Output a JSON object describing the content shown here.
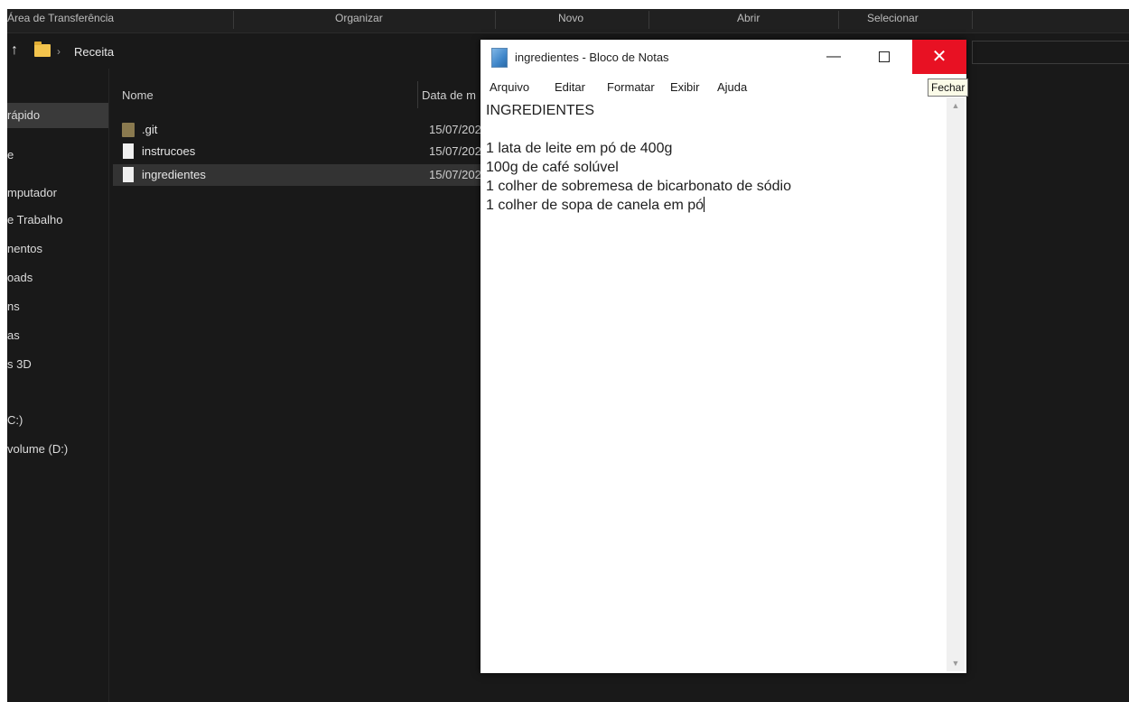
{
  "ribbon": {
    "groups": [
      "Área de Transferência",
      "Organizar",
      "Novo",
      "Abrir",
      "Selecionar"
    ]
  },
  "address": {
    "crumb": "Receita"
  },
  "nav": {
    "items": [
      "rápido",
      "e",
      "mputador",
      "e Trabalho",
      "nentos",
      "oads",
      "ns",
      "as",
      "s 3D",
      "",
      "C:)",
      "volume (D:)"
    ]
  },
  "files": {
    "col_name": "Nome",
    "col_date": "Data de m",
    "rows": [
      {
        "name": ".git",
        "date": "15/07/202",
        "type": "folder"
      },
      {
        "name": "instrucoes",
        "date": "15/07/202",
        "type": "doc"
      },
      {
        "name": "ingredientes",
        "date": "15/07/202",
        "type": "doc",
        "selected": true
      }
    ]
  },
  "notepad": {
    "title": "ingredientes - Bloco de Notas",
    "menu": [
      "Arquivo",
      "Editar",
      "Formatar",
      "Exibir",
      "Ajuda"
    ],
    "lines": [
      "INGREDIENTES",
      "",
      "1 lata de leite em pó de 400g",
      "100g de café solúvel",
      "1 colher de sobremesa de bicarbonato de sódio",
      "1 colher de sopa de canela em pó"
    ],
    "close_glyph": "✕",
    "minimize_glyph": "—"
  },
  "tooltip": {
    "text": "Fechar"
  },
  "colors": {
    "close_red": "#e81123",
    "explorer_bg": "#191919",
    "folder_yellow": "#f3c44d"
  }
}
